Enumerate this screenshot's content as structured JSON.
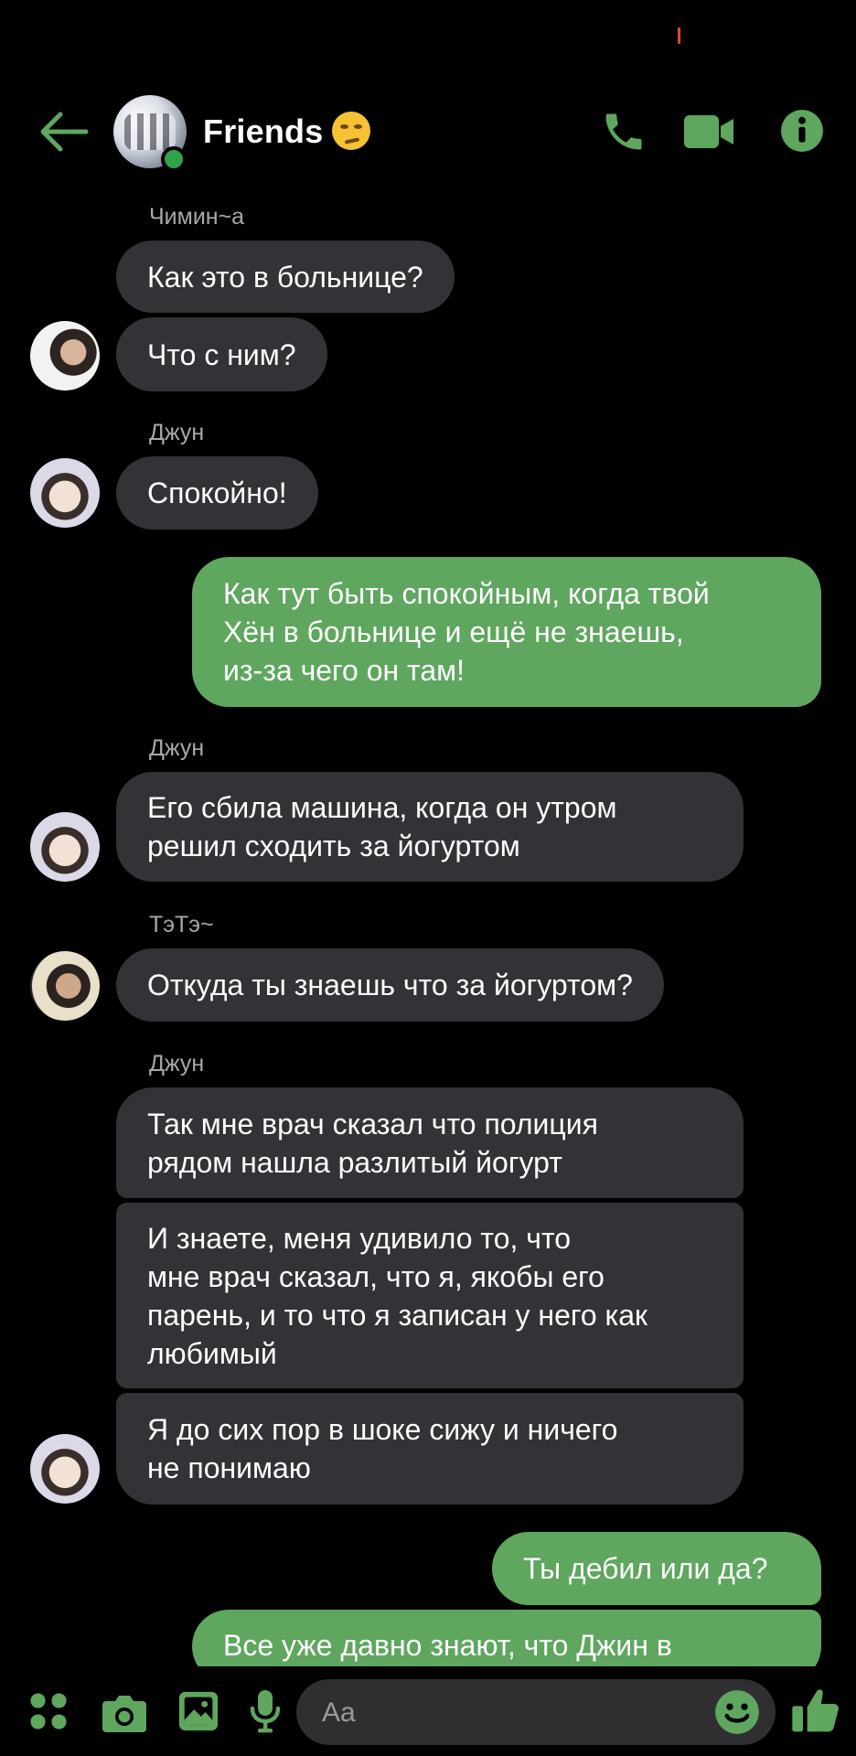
{
  "colors": {
    "accent": "#5fa65f",
    "incoming_bubble": "#333236",
    "outgoing_bubble": "#5fa65f",
    "online": "#31a24c",
    "background": "#000000"
  },
  "header": {
    "title": "Friends",
    "title_emoji": "woozy-face-emoji",
    "icons": [
      "back-arrow-icon",
      "phone-icon",
      "video-camera-icon",
      "info-icon"
    ]
  },
  "messages": [
    {
      "sender": "Чимин~a"
    },
    {
      "text": "Как это в больнице?",
      "direction": "in"
    },
    {
      "text": "Что с ним?",
      "direction": "in"
    },
    {
      "sender": "Джун"
    },
    {
      "text": "Спокойно!",
      "direction": "in"
    },
    {
      "text": "Как тут быть спокойным, когда твой\nХён в больнице и ещё не знаешь,\nиз-за чего он там!",
      "direction": "out"
    },
    {
      "sender": "Джун"
    },
    {
      "text": "Его сбила машина, когда он утром\nрешил сходить за йогуртом",
      "direction": "in"
    },
    {
      "sender": "ТэТэ~"
    },
    {
      "text": "Откуда ты знаешь что за йогуртом?",
      "direction": "in"
    },
    {
      "sender": "Джун"
    },
    {
      "text": "Так мне врач сказал что полиция\nрядом нашла разлитый йогурт",
      "direction": "in"
    },
    {
      "text": "И знаете, меня удивило то, что\nмне врач сказал, что я, якобы его\nпарень, и то что я записан у него как\nлюбимый",
      "direction": "in"
    },
    {
      "text": "Я до сих пор в шоке сижу и ничего\nне понимаю",
      "direction": "in"
    },
    {
      "text": "Ты дебил или да?",
      "direction": "out"
    },
    {
      "text": "Все уже давно знают, что Джин в",
      "direction": "out"
    }
  ],
  "composer": {
    "placeholder": "Aa"
  },
  "bottom_icons": [
    "apps-icon",
    "camera-icon",
    "gallery-icon",
    "microphone-icon",
    "emoji-icon",
    "thumbs-up-icon"
  ]
}
